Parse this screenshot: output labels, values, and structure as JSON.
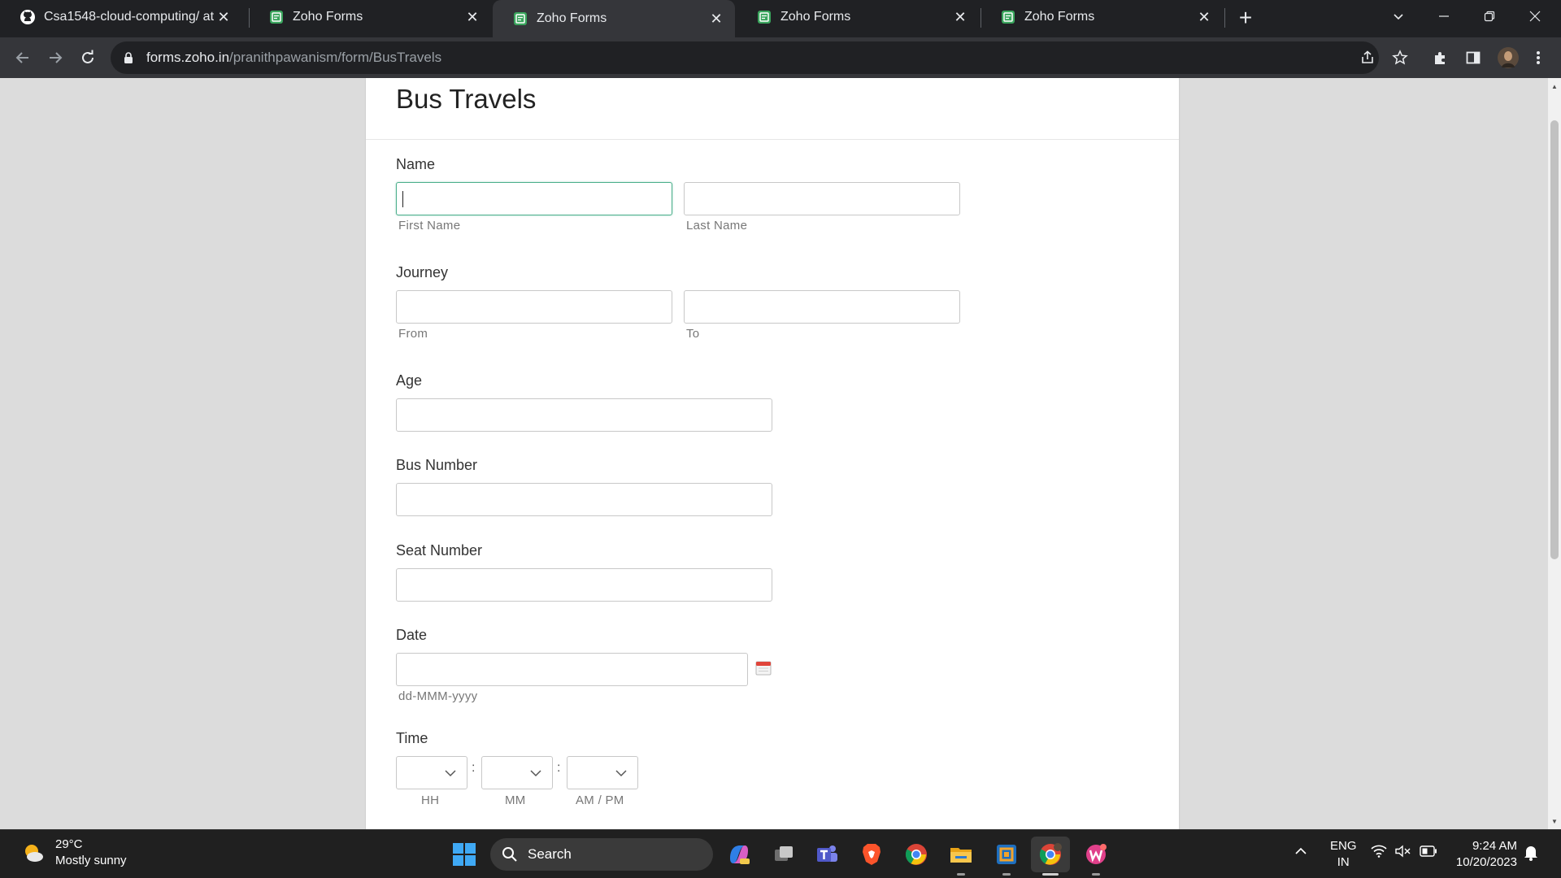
{
  "browser": {
    "tabs": [
      {
        "title": "Csa1548-cloud-computing/ at m",
        "icon": "github-icon",
        "active": false
      },
      {
        "title": "Zoho Forms",
        "icon": "zoho-forms-icon",
        "active": false
      },
      {
        "title": "Zoho Forms",
        "icon": "zoho-forms-icon",
        "active": true
      },
      {
        "title": "Zoho Forms",
        "icon": "zoho-forms-icon",
        "active": false
      },
      {
        "title": "Zoho Forms",
        "icon": "zoho-forms-icon",
        "active": false
      }
    ],
    "url_host": "forms.zoho.in",
    "url_path": "/pranithpawanism/form/BusTravels"
  },
  "form": {
    "title": "Bus Travels",
    "name": {
      "label": "Name",
      "first_sublabel": "First Name",
      "last_sublabel": "Last Name",
      "first_value": "",
      "last_value": ""
    },
    "journey": {
      "label": "Journey",
      "from_sublabel": "From",
      "to_sublabel": "To"
    },
    "age": {
      "label": "Age"
    },
    "bus_number": {
      "label": "Bus Number"
    },
    "seat_number": {
      "label": "Seat Number"
    },
    "date": {
      "label": "Date",
      "format_hint": "dd-MMM-yyyy"
    },
    "time": {
      "label": "Time",
      "hh": "HH",
      "mm": "MM",
      "ampm": "AM / PM",
      "separator": ":"
    }
  },
  "taskbar": {
    "weather_temp": "29°C",
    "weather_desc": "Mostly sunny",
    "search_placeholder": "Search",
    "lang_top": "ENG",
    "lang_bottom": "IN",
    "time": "9:24 AM",
    "date": "10/20/2023"
  },
  "colors": {
    "focus_border": "#4caf8c",
    "calendar_red": "#e0443a"
  }
}
